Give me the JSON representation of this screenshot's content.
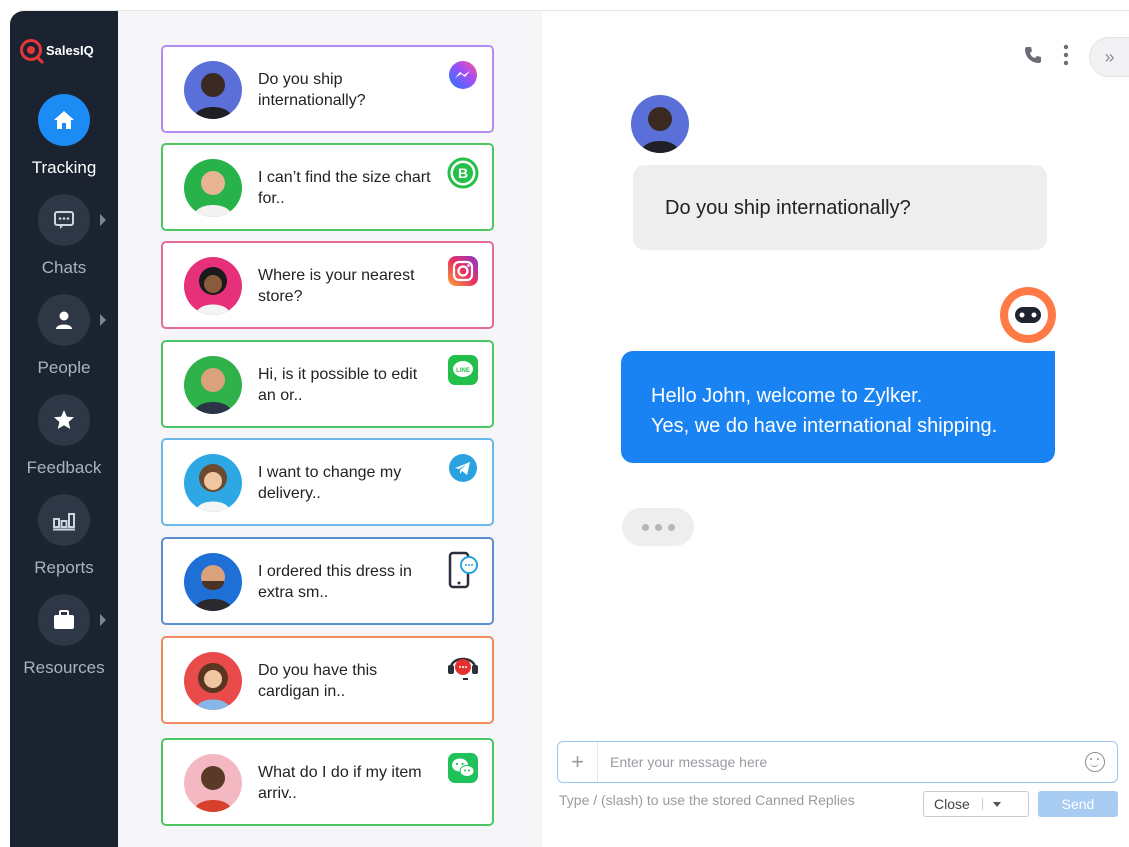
{
  "brand": {
    "name": "SalesIQ",
    "color": "#e4373a"
  },
  "nav": [
    {
      "label": "Tracking",
      "icon": "home-icon",
      "active": true
    },
    {
      "label": "Chats",
      "icon": "chat-icon",
      "active": false
    },
    {
      "label": "People",
      "icon": "person-icon",
      "active": false
    },
    {
      "label": "Feedback",
      "icon": "star-icon",
      "active": false
    },
    {
      "label": "Reports",
      "icon": "reports-icon",
      "active": false
    },
    {
      "label": "Resources",
      "icon": "briefcase-icon",
      "active": false
    }
  ],
  "conversations": [
    {
      "message": "Do you ship internationally?",
      "channel": "messenger-icon",
      "border": "#b48cf0"
    },
    {
      "message": "I can’t find the size chart for..",
      "channel": "whatsapp-business-icon",
      "border": "#4cc764"
    },
    {
      "message": "Where is your nearest store?",
      "channel": "instagram-icon",
      "border": "#e66a9a"
    },
    {
      "message": "Hi, is it possible to edit an or..",
      "channel": "line-icon",
      "border": "#4cc764"
    },
    {
      "message": "I want to change my delivery..",
      "channel": "telegram-icon",
      "border": "#6ab8e8"
    },
    {
      "message": "I ordered this dress in extra sm..",
      "channel": "mobile-chat-icon",
      "border": "#5b8fd1"
    },
    {
      "message": "Do you have this cardigan in..",
      "channel": "headset-chat-icon",
      "border": "#f08a5c"
    },
    {
      "message": "What do I do if my item arriv..",
      "channel": "wechat-icon",
      "border": "#4cc764"
    }
  ],
  "chat": {
    "incoming": "Do you ship internationally?",
    "outgoing_line1": "Hello John, welcome to Zylker.",
    "outgoing_line2": "Yes, we do have international shipping."
  },
  "composer": {
    "placeholder": "Enter your message here",
    "hint": "Type / (slash) to use the stored Canned Replies",
    "close_label": "Close",
    "send_label": "Send"
  },
  "colors": {
    "sidebar": "#1b2331",
    "accent": "#1a83f4"
  }
}
